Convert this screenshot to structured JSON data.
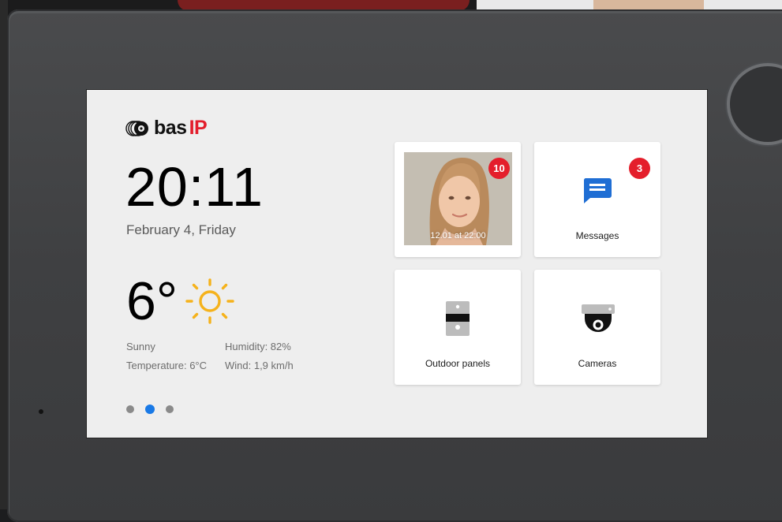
{
  "brand": {
    "name": "bas",
    "suffix": "IP",
    "suffix_color": "#e31d2b"
  },
  "clock": {
    "time": "20:11",
    "date": "February 4, Friday"
  },
  "weather": {
    "temperature": "6°",
    "condition": "Sunny",
    "humidity": "Humidity: 82%",
    "temperature_detail": "Temperature: 6°C",
    "wind": "Wind: 1,9 km/h",
    "icon": "sun-icon",
    "icon_color": "#f5b21b"
  },
  "pager": {
    "pages": 3,
    "active_page": 2,
    "active_color": "#1979e6"
  },
  "tiles": {
    "call_log": {
      "caption": "12.01 at 22:00",
      "badge": "10"
    },
    "messages": {
      "label": "Messages",
      "badge": "3",
      "icon": "message-icon",
      "icon_color": "#1f6ed4"
    },
    "outdoor_panels": {
      "label": "Outdoor panels",
      "icon": "outdoor-panel-icon"
    },
    "cameras": {
      "label": "Cameras",
      "icon": "camera-icon"
    }
  },
  "colors": {
    "badge": "#e41e2b",
    "screen_bg": "#eeeeee",
    "tile_bg": "#ffffff"
  }
}
